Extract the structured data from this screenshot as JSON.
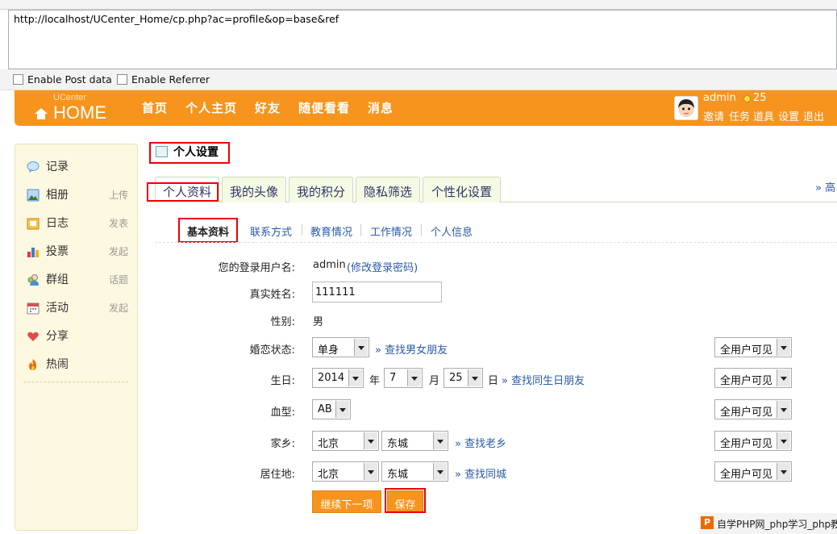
{
  "browser": {
    "url": "http://localhost/UCenter_Home/cp.php?ac=profile&op=base&ref",
    "enable_post_label": "Enable Post data",
    "enable_referrer_label": "Enable Referrer"
  },
  "header": {
    "logo_small": "UCenter",
    "logo_big": "HOME",
    "nav": [
      "首页",
      "个人主页",
      "好友",
      "随便看看",
      "消息"
    ],
    "user_name": "admin",
    "credits": "25",
    "links": [
      "邀请",
      "任务",
      "道具",
      "设置",
      "退出"
    ]
  },
  "sidebar": {
    "items": [
      {
        "label": "记录",
        "sub": "",
        "icon": "bubble-icon",
        "color": "#5aa0d8"
      },
      {
        "label": "相册",
        "sub": "上传",
        "icon": "photo-icon",
        "color": "#4a8fd0"
      },
      {
        "label": "日志",
        "sub": "发表",
        "icon": "notebook-icon",
        "color": "#f0a020"
      },
      {
        "label": "投票",
        "sub": "发起",
        "icon": "bar-chart-icon",
        "color": "#3a7"
      },
      {
        "label": "群组",
        "sub": "话题",
        "icon": "group-icon",
        "color": "#5b8"
      },
      {
        "label": "活动",
        "sub": "发起",
        "icon": "calendar-icon",
        "color": "#c55"
      },
      {
        "label": "分享",
        "sub": "",
        "icon": "heart-icon",
        "color": "#d33"
      },
      {
        "label": "热闹",
        "sub": "",
        "icon": "fire-icon",
        "color": "#e60"
      }
    ]
  },
  "main": {
    "title": "个人设置",
    "tabs": [
      "个人资料",
      "我的头像",
      "我的积分",
      "隐私筛选",
      "个性化设置"
    ],
    "tab_more": "» 高",
    "subtabs": [
      "基本资料",
      "联系方式",
      "教育情况",
      "工作情况",
      "个人信息"
    ]
  },
  "form": {
    "login_label": "您的登录用户名:",
    "login_value": "admin",
    "change_password": "(修改登录密码)",
    "realname_label": "真实姓名:",
    "realname_value": "111111",
    "gender_label": "性别:",
    "gender_value": "男",
    "marital_label": "婚恋状态:",
    "marital_value": "单身",
    "marital_link": "» 查找男女朋友",
    "birthday_label": "生日:",
    "birth_year": "2014",
    "year_unit": "年",
    "birth_month": "7",
    "month_unit": "月",
    "birth_day": "25",
    "day_unit": "日",
    "birthday_link": "» 查找同生日朋友",
    "blood_label": "血型:",
    "blood_value": "AB",
    "hometown_label": "家乡:",
    "hometown_province": "北京",
    "hometown_city": "东城",
    "hometown_link": "» 查找老乡",
    "residence_label": "居住地:",
    "residence_province": "北京",
    "residence_city": "东城",
    "residence_link": "» 查找同城",
    "privacy_value": "全用户可见",
    "next_button": "继续下一项",
    "save_button": "保存"
  },
  "watermark": {
    "icon": "P",
    "text": "自学PHP网_php学习_php教"
  }
}
